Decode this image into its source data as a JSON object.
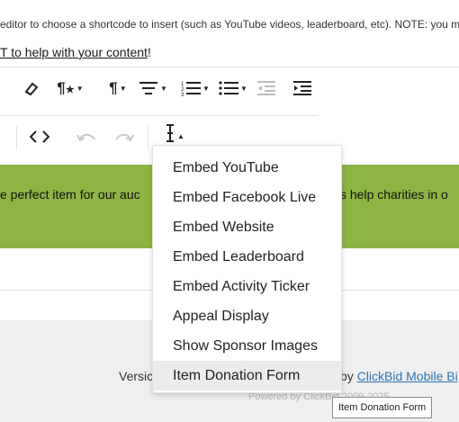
{
  "instructions": {
    "text": "editor to choose a shortcode to insert (such as YouTube videos, leaderboard, etc). NOTE: you m",
    "help_link": "T to help with your content",
    "help_suffix": "!"
  },
  "banner": {
    "text_left": "e perfect item for our auc",
    "text_right": "s help charities in o",
    "color": "#8db543"
  },
  "footer": {
    "version_label": "Versic",
    "by_label": "by ",
    "link_text": "ClickBid Mobile Bi",
    "powered": "Powered by ClickBid 2009-2025",
    "link_color": "#2a75b8"
  },
  "toolbar": {
    "row1": [
      "eraser-icon",
      "paragraph-style-icon",
      "paragraph-icon",
      "align-icon",
      "ordered-list-icon",
      "unordered-list-icon",
      "outdent-icon",
      "indent-icon"
    ],
    "row2": [
      "code-view-icon",
      "undo-icon",
      "redo-icon",
      "shortcode-cursor-icon"
    ]
  },
  "shortcode_menu": {
    "items": [
      "Embed YouTube",
      "Embed Facebook Live",
      "Embed Website",
      "Embed Leaderboard",
      "Embed Activity Ticker",
      "Appeal Display",
      "Show Sponsor Images",
      "Item Donation Form"
    ],
    "highlighted": "Item Donation Form"
  },
  "tooltip": {
    "text": "Item Donation Form"
  }
}
